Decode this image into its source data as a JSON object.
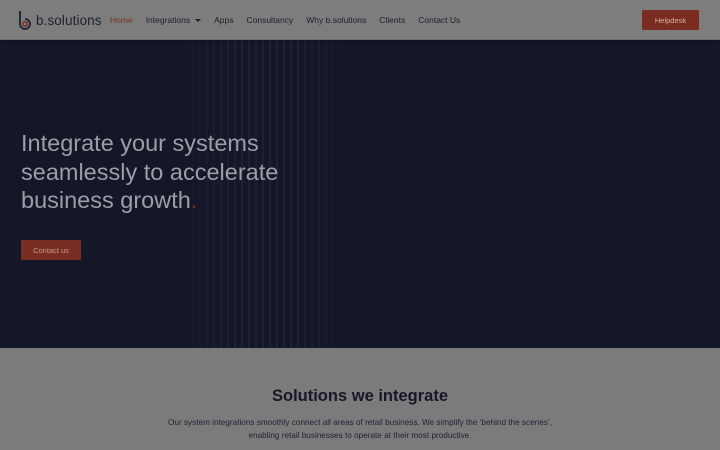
{
  "header": {
    "logo_text": "b.solutions",
    "nav": [
      {
        "label": "Home",
        "active": true
      },
      {
        "label": "Integrations",
        "dropdown": true
      },
      {
        "label": "Apps"
      },
      {
        "label": "Consultancy"
      },
      {
        "label": "Why b.solutions"
      },
      {
        "label": "Clients"
      },
      {
        "label": "Contact Us"
      }
    ],
    "helpdesk_label": "Helpdesk"
  },
  "hero": {
    "title_line1": "Integrate your systems",
    "title_line2": "seamlessly to accelerate",
    "title_line3": "business growth",
    "title_dot": ".",
    "cta_label": "Contact us"
  },
  "solutions": {
    "title": "Solutions we integrate",
    "text_line1": "Our system integrations smoothly connect all areas of retail business. We simplify the ‘behind the scenes’,",
    "text_line2": "enabling retail businesses to operate at their most productive."
  },
  "colors": {
    "accent": "#e04a36",
    "hero_bg": "#141728",
    "overlay_dim": "#7b7b7b"
  }
}
